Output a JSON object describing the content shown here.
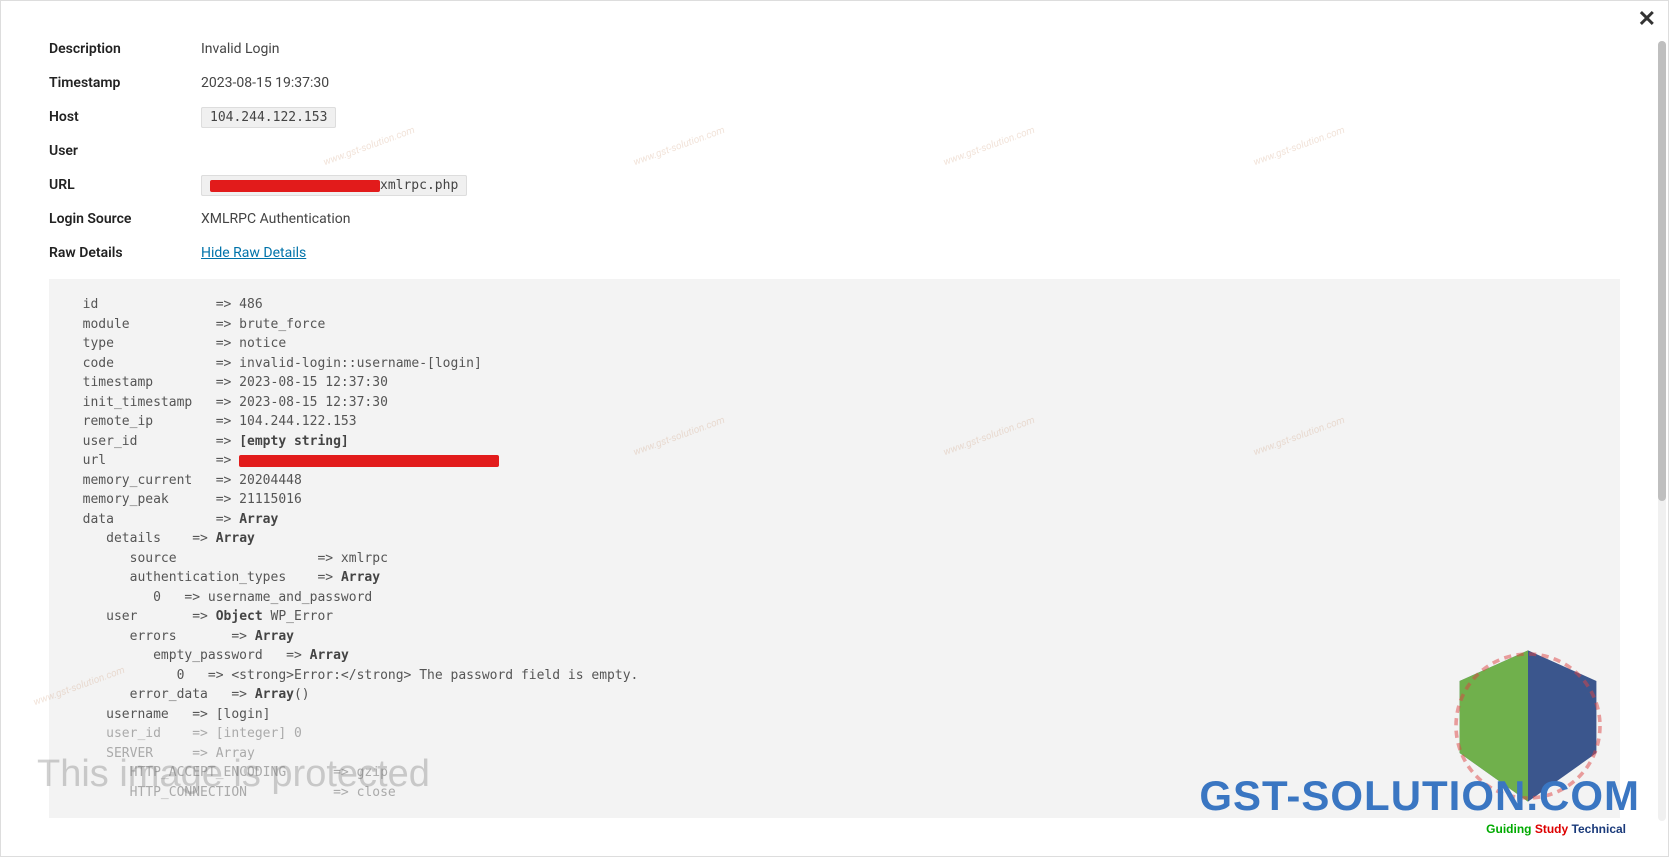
{
  "close_icon": "✕",
  "rows": {
    "description": {
      "label": "Description",
      "value": "Invalid Login"
    },
    "timestamp": {
      "label": "Timestamp",
      "value": "2023-08-15 19:37:30"
    },
    "host": {
      "label": "Host",
      "value": "104.244.122.153"
    },
    "user": {
      "label": "User",
      "value": ""
    },
    "url": {
      "label": "URL",
      "suffix": "xmlrpc.php"
    },
    "login_source": {
      "label": "Login Source",
      "value": "XMLRPC Authentication"
    },
    "raw_details": {
      "label": "Raw Details",
      "toggle": "Hide Raw Details"
    }
  },
  "raw": {
    "l1": "  id               => 486",
    "l2": "  module           => brute_force",
    "l3": "  type             => notice",
    "l4": "  code             => invalid-login::username-[login]",
    "l5": "  timestamp        => 2023-08-15 12:37:30",
    "l6": "  init_timestamp   => 2023-08-15 12:37:30",
    "l7": "  remote_ip        => 104.244.122.153",
    "l8a": "  user_id          => ",
    "l8b": "[empty string]",
    "l9": "  url              => ",
    "l10": "  memory_current   => 20204448",
    "l11": "  memory_peak      => 21115016",
    "l12a": "  data             => ",
    "l12b": "Array",
    "l13a": "     details    => ",
    "l13b": "Array",
    "l14": "        source                  => xmlrpc",
    "l15a": "        authentication_types    => ",
    "l15b": "Array",
    "l16": "           0   => username_and_password",
    "l17a": "     user       => ",
    "l17b": "Object",
    "l17c": " WP_Error",
    "l18a": "        errors       => ",
    "l18b": "Array",
    "l19a": "           empty_password   => ",
    "l19b": "Array",
    "l20": "              0   => <strong>Error:</strong> The password field is empty.",
    "l21a": "        error_data   => ",
    "l21b": "Array",
    "l21c": "()",
    "l22": "     username   => [login]",
    "l23": "     user_id    => [integer] 0",
    "l24": "     SERVER     => Array",
    "l25": "        HTTP_ACCEPT_ENCODING      => gzip",
    "l26": "        HTTP_CONNECTION           => close"
  },
  "watermarks": {
    "protected": "This image is protected",
    "brand": "GST-SOLUTION.COM",
    "sub1": "Guiding",
    "sub2": "Study",
    "sub3": "Technical"
  }
}
